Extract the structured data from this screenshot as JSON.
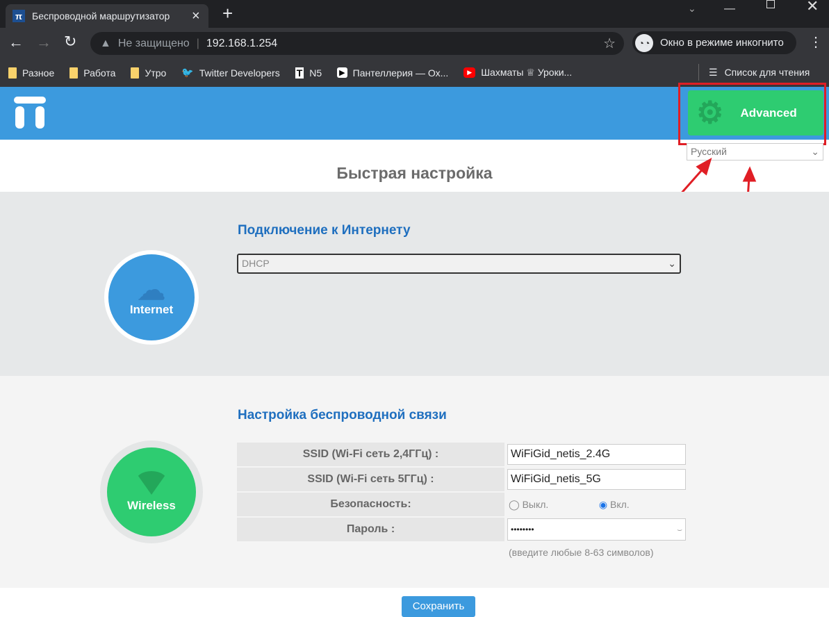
{
  "browser": {
    "tab_title": "Беспроводной маршрутизатор",
    "tab_close": "×",
    "new_tab": "+",
    "not_secure": "Не защищено",
    "url": "192.168.1.254",
    "incognito": "Окно в режиме инкогнито",
    "reading_list": "Список для чтения",
    "bookmarks": [
      "Разное",
      "Работа",
      "Утро",
      "Twitter Developers",
      "N5",
      "Пантеллерия — Ох...",
      "Шахматы ♕ Уроки..."
    ]
  },
  "header": {
    "advanced": "Advanced",
    "language": "Русский"
  },
  "page": {
    "title": "Быстрая настройка",
    "internet": {
      "heading": "Подключение к Интернету",
      "circle": "Internet",
      "type": "DHCP"
    },
    "wireless": {
      "heading": "Настройка беспроводной связи",
      "circle": "Wireless",
      "ssid24_label": "SSID (Wi-Fi сеть 2,4ГГц) :",
      "ssid24": "WiFiGid_netis_2.4G",
      "ssid5_label": "SSID (Wi-Fi сеть 5ГГц) :",
      "ssid5": "WiFiGid_netis_5G",
      "security_label": "Безопасность:",
      "off": "Выкл.",
      "on": "Вкл.",
      "password_label": "Пароль :",
      "password": "••••••••",
      "hint": "(введите любые 8-63 символов)"
    },
    "save": "Сохранить"
  }
}
